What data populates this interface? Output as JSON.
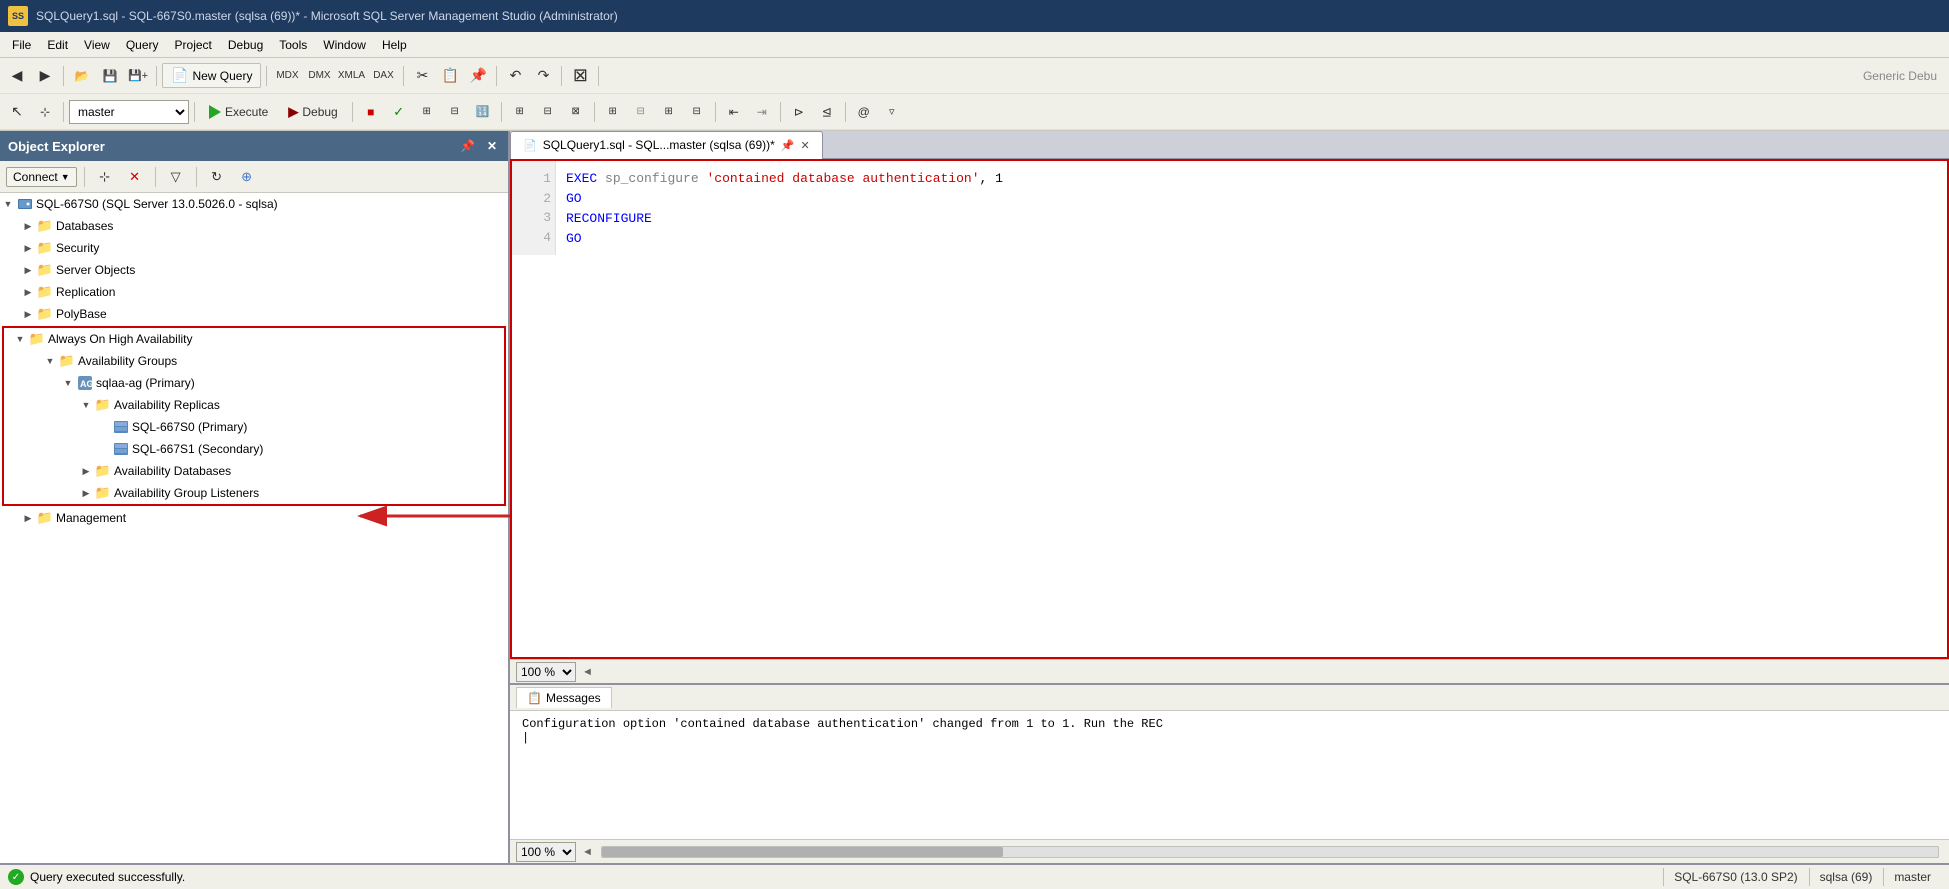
{
  "titleBar": {
    "title": "SQLQuery1.sql - SQL-667S0.master (sqlsa (69))* - Microsoft SQL Server Management Studio (Administrator)",
    "icon": "SS"
  },
  "menuBar": {
    "items": [
      "File",
      "Edit",
      "View",
      "Query",
      "Project",
      "Debug",
      "Tools",
      "Window",
      "Help"
    ]
  },
  "toolbar1": {
    "newQuery": "New Query",
    "buttons": [
      "back",
      "forward",
      "open",
      "save",
      "save-all",
      "new-query",
      "copy1",
      "copy2",
      "copy3",
      "cut",
      "copy",
      "paste",
      "undo",
      "redo",
      "debug-stop"
    ]
  },
  "toolbar2": {
    "database": "master",
    "execute": "Execute",
    "debug": "Debug"
  },
  "objectExplorer": {
    "title": "Object Explorer",
    "connectLabel": "Connect",
    "serverNode": "SQL-667S0 (SQL Server 13.0.5026.0 - sqlsa)",
    "items": [
      {
        "label": "Databases",
        "level": 1,
        "expanded": false
      },
      {
        "label": "Security",
        "level": 1,
        "expanded": false
      },
      {
        "label": "Server Objects",
        "level": 1,
        "expanded": false
      },
      {
        "label": "Replication",
        "level": 1,
        "expanded": false
      },
      {
        "label": "PolyBase",
        "level": 1,
        "expanded": false
      },
      {
        "label": "Always On High Availability",
        "level": 1,
        "expanded": true
      },
      {
        "label": "Availability Groups",
        "level": 2,
        "expanded": true
      },
      {
        "label": "sqlaa-ag (Primary)",
        "level": 3,
        "expanded": true
      },
      {
        "label": "Availability Replicas",
        "level": 4,
        "expanded": true
      },
      {
        "label": "SQL-667S0 (Primary)",
        "level": 5,
        "expanded": false,
        "selected": false
      },
      {
        "label": "SQL-667S1 (Secondary)",
        "level": 5,
        "expanded": false
      },
      {
        "label": "Availability Databases",
        "level": 4,
        "expanded": false
      },
      {
        "label": "Availability Group Listeners",
        "level": 4,
        "expanded": false
      }
    ],
    "managementItem": "Management"
  },
  "queryTab": {
    "title": "SQLQuery1.sql - SQL...master (sqlsa (69))*",
    "pinIcon": "⊕",
    "closeIcon": "×"
  },
  "queryCode": {
    "line1": "EXEC sp_configure 'contained database authentication', 1",
    "line2": "GO",
    "line3": "RECONFIGURE",
    "line4": "GO",
    "keyword_exec": "EXEC",
    "keyword_sp": "sp_configure",
    "keyword_go": "GO",
    "keyword_reconfig": "RECONFIGURE"
  },
  "zoomLevel1": "100 %",
  "results": {
    "tabLabel": "Messages",
    "message": "Configuration option 'contained database authentication' changed from 1 to 1. Run the REC"
  },
  "zoomLevel2": "100 %",
  "statusBar": {
    "successMessage": "Query executed successfully.",
    "server": "SQL-667S0 (13.0 SP2)",
    "user": "sqlsa (69)",
    "database": "master"
  },
  "arrowText": "→"
}
